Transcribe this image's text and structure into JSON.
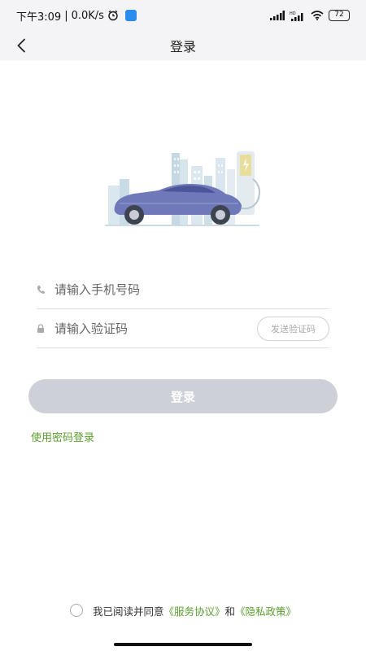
{
  "status_bar": {
    "time": "下午3:09",
    "separator": "|",
    "net_speed": "0.0K/s",
    "battery": "72",
    "icons": [
      "alarm-icon",
      "app-notification-icon",
      "signal-icon",
      "hd-signal-icon",
      "wifi-icon",
      "battery-icon"
    ]
  },
  "nav": {
    "title": "登录",
    "back_icon": "chevron-left-icon"
  },
  "form": {
    "phone_placeholder": "请输入手机号码",
    "phone_value": "",
    "code_placeholder": "请输入验证码",
    "code_value": "",
    "send_code_label": "发送验证码"
  },
  "login_button": "登录",
  "password_login_link": "使用密码登录",
  "agreement": {
    "prefix": "我已阅读并同意",
    "service": "《服务协议》",
    "and": "和",
    "privacy": "《隐私政策》"
  },
  "colors": {
    "accent_green": "#5a9e2f",
    "login_button_disabled": "#cdd0d6",
    "header_bg": "#f4f4f6"
  }
}
